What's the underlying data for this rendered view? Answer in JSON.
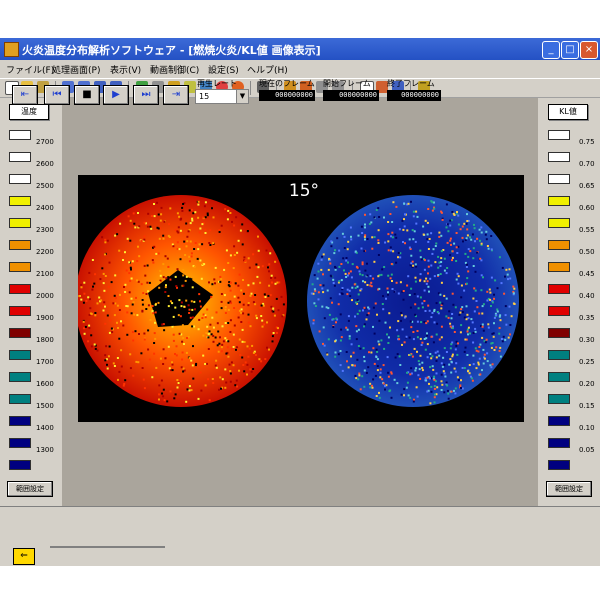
{
  "window": {
    "title": "火炎温度分布解析ソフトウェア - [燃焼火炎/KL値 画像表示]",
    "buttons": {
      "minimize": "_",
      "maximize": "□",
      "close": "×"
    }
  },
  "menu": [
    "ファイル(F)",
    "処理画面(P)",
    "表示(V)",
    "動画制御(C)",
    "設定(S)",
    "ヘルプ(H)"
  ],
  "left_legend": {
    "header": "温度",
    "swatches": [
      "#ffffff",
      "#ffffff",
      "#ffffff",
      "#f0f000",
      "#f0f000",
      "#f09000",
      "#f09000",
      "#e00000",
      "#e00000",
      "#800000",
      "#008080",
      "#008080",
      "#008080",
      "#000080",
      "#000080",
      "#000080"
    ],
    "values": [
      "2700",
      "2600",
      "2500",
      "2400",
      "2300",
      "2200",
      "2100",
      "2000",
      "1900",
      "1800",
      "1700",
      "1600",
      "1500",
      "1400",
      "1300"
    ],
    "range_button": "範囲設定"
  },
  "right_legend": {
    "header": "KL値",
    "swatches": [
      "#ffffff",
      "#ffffff",
      "#ffffff",
      "#f0f000",
      "#f0f000",
      "#f09000",
      "#f09000",
      "#e00000",
      "#e00000",
      "#800000",
      "#008080",
      "#008080",
      "#008080",
      "#000080",
      "#000080",
      "#000080"
    ],
    "values": [
      "0.75",
      "0.70",
      "0.65",
      "0.60",
      "0.55",
      "0.50",
      "0.45",
      "0.40",
      "0.35",
      "0.30",
      "0.25",
      "0.20",
      "0.15",
      "0.10",
      "0.05"
    ],
    "range_button": "範囲設定"
  },
  "image": {
    "angle": "15°"
  },
  "controls": {
    "rate_label": "再生レート",
    "rate_value": "15",
    "current_frame_label": "現在のフレーム",
    "current_frame_value": "000000000",
    "start_frame_label": "開始フレーム",
    "start_frame_value": "000000000",
    "end_frame_label": "終了フレーム",
    "end_frame_value": "000000000"
  },
  "colors": {
    "title_bar": "#2451c4",
    "window_bg": "#d4d0c8",
    "viewer_bg": "#aaa59c",
    "control_icon": "#1f3fcf"
  }
}
